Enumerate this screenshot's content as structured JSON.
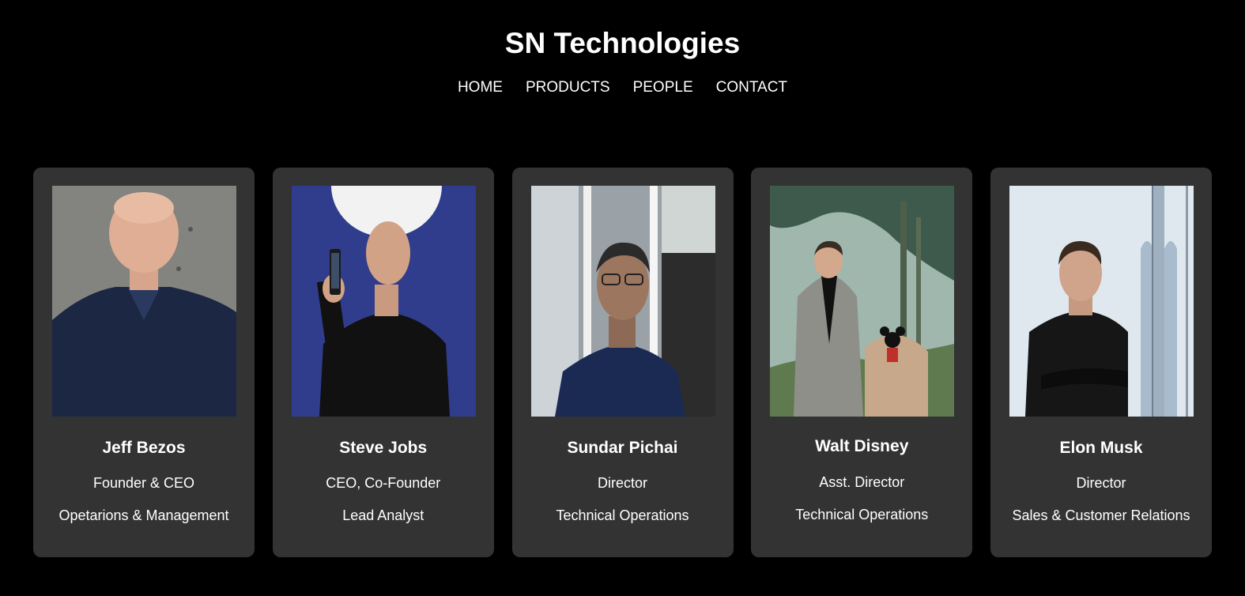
{
  "header": {
    "title": "SN Technologies"
  },
  "nav": {
    "items": [
      "HOME",
      "PRODUCTS",
      "PEOPLE",
      "CONTACT"
    ]
  },
  "people": [
    {
      "name": "Jeff Bezos",
      "role": "Founder & CEO",
      "department": "Opetarions & Management"
    },
    {
      "name": "Steve Jobs",
      "role": "CEO, Co-Founder",
      "department": "Lead Analyst"
    },
    {
      "name": "Sundar Pichai",
      "role": "Director",
      "department": "Technical Operations"
    },
    {
      "name": "Walt Disney",
      "role": "Asst. Director",
      "department": "Technical Operations"
    },
    {
      "name": "Elon Musk",
      "role": "Director",
      "department": "Sales & Customer Relations"
    }
  ],
  "colors": {
    "page_background": "#000000",
    "card_background": "#333333",
    "text": "#ffffff"
  }
}
